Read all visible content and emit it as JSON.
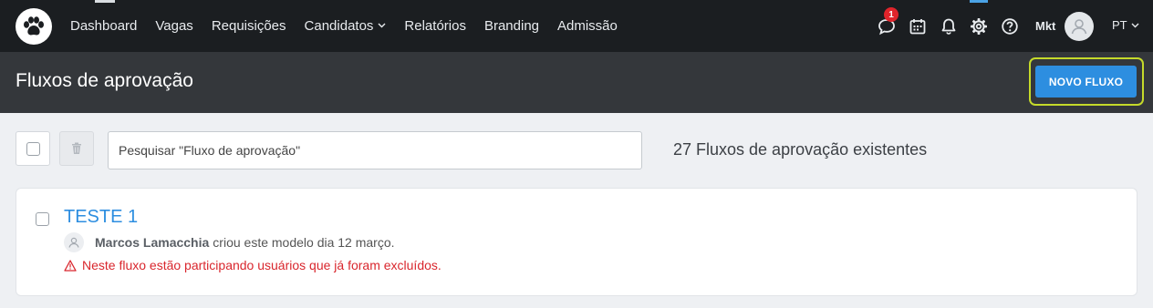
{
  "nav": {
    "links": [
      {
        "label": "Dashboard"
      },
      {
        "label": "Vagas"
      },
      {
        "label": "Requisições"
      },
      {
        "label": "Candidatos"
      },
      {
        "label": "Relatórios"
      },
      {
        "label": "Branding"
      },
      {
        "label": "Admissão"
      }
    ],
    "notification_count": "1",
    "user_name": "Mkt",
    "language": "PT"
  },
  "header": {
    "title": "Fluxos de aprovação",
    "new_button_label": "NOVO FLUXO"
  },
  "toolbar": {
    "search_placeholder": "Pesquisar \"Fluxo de aprovação\"",
    "count_text": "27 Fluxos de aprovação existentes"
  },
  "flows": [
    {
      "title": "TESTE 1",
      "author": "Marcos Lamacchia",
      "meta_text": "criou este modelo dia 12 março.",
      "warning": "Neste fluxo estão participando usuários que já foram excluídos."
    }
  ],
  "colors": {
    "accent": "#2d8ee0",
    "highlight": "#c5da2a",
    "warning": "#d9262d",
    "badge": "#e0242b"
  },
  "icons": {
    "logo": "paw-icon",
    "chat": "chat-icon",
    "calendar": "calendar-icon",
    "bell": "bell-icon",
    "settings": "gear-icon",
    "help": "help-icon",
    "delete": "trash-icon",
    "warning": "warning-icon"
  }
}
